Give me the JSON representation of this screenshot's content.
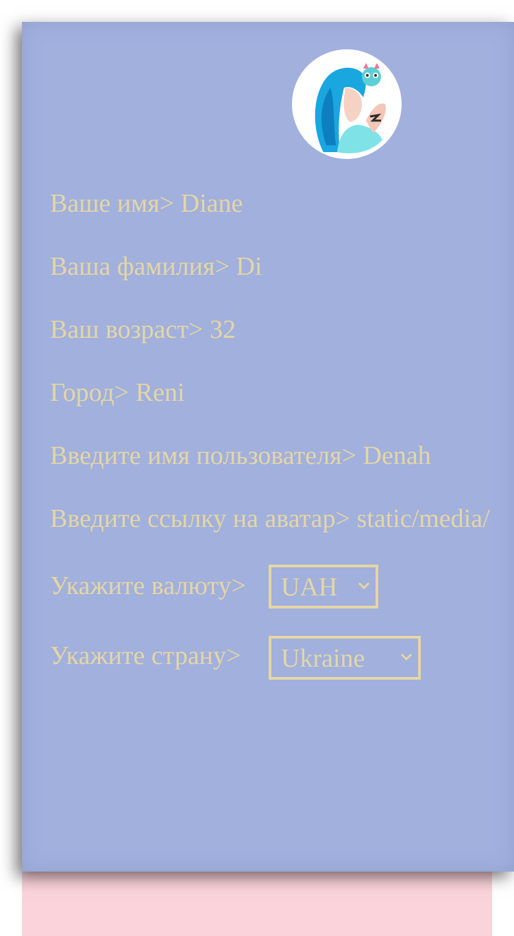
{
  "profile": {
    "avatar_alt": "avatar",
    "fields": [
      {
        "label": "Ваше имя",
        "sep": "> ",
        "value": "Diane"
      },
      {
        "label": "Ваша фамилия",
        "sep": "> ",
        "value": "Di"
      },
      {
        "label": "Ваш возраст",
        "sep": "> ",
        "value": "32"
      },
      {
        "label": "Город",
        "sep": "> ",
        "value": "Reni"
      },
      {
        "label": "Введите имя пользователя",
        "sep": "> ",
        "value": "Denah"
      },
      {
        "label": "Введите ссылку на аватар",
        "sep": "> ",
        "value": "static/media/"
      }
    ],
    "currency": {
      "label": "Укажите валюту>",
      "selected": "UAH"
    },
    "country": {
      "label": "Укажите страну>",
      "selected": "Ukraine"
    }
  },
  "colors": {
    "card_bg": "#a1b0dd",
    "text": "#e5d6a4",
    "strip": "#fbd3da"
  }
}
